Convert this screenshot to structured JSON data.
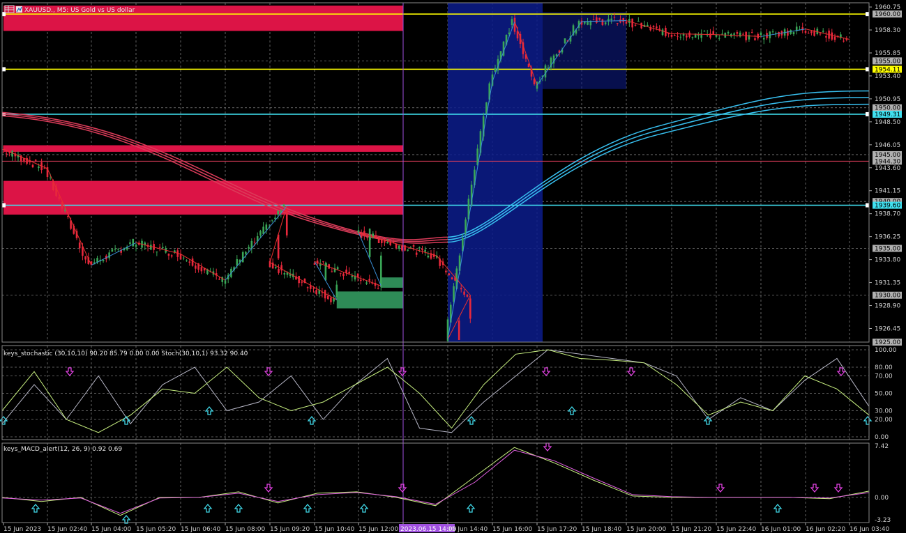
{
  "colors": {
    "background": "#000000",
    "bull_candle": "#3aa757",
    "bear_candle": "#e8283c",
    "session_box": "#0c1c8c",
    "supply_zone": "#dc1446",
    "demand_zone": "#2e8b57",
    "yellow_line": "#ffff00",
    "cyan_line": "#40e0f0",
    "ma_red": "#dc3c5a",
    "ma_blue": "#38c0f0",
    "zigzag_red": "#e83030",
    "zigzag_blue": "#3a8fd8",
    "arrow_down": "#e040e0",
    "arrow_up": "#40d8e8"
  },
  "header": {
    "menu_icon": "chart-window-icon",
    "title": "XAUUSD., M5:  US Gold vs US dollar"
  },
  "main_chart": {
    "price_ticks": [
      "1960.75",
      "1958.30",
      "1955.85",
      "1953.40",
      "1950.95",
      "1948.50",
      "1946.05",
      "1943.60",
      "1941.15",
      "1938.70",
      "1936.25",
      "1933.80",
      "1931.35",
      "1928.90",
      "1926.45"
    ],
    "level_tags": [
      {
        "label": "1960.00",
        "value": 1960.0,
        "bg": "#b0b0b0"
      },
      {
        "label": "1955.00",
        "value": 1955.0,
        "bg": "#b0b0b0"
      },
      {
        "label": "1954.11",
        "value": 1954.11,
        "bg": "#ffff00"
      },
      {
        "label": "1950.00",
        "value": 1950.0,
        "bg": "#b0b0b0"
      },
      {
        "label": "1949.31",
        "value": 1949.31,
        "bg": "#40e0f0"
      },
      {
        "label": "1945.00",
        "value": 1945.0,
        "bg": "#b0b0b0"
      },
      {
        "label": "1944.30",
        "value": 1944.3,
        "bg": "#b0b0b0"
      },
      {
        "label": "1940.00",
        "value": 1940.0,
        "bg": "#b0b0b0"
      },
      {
        "label": "1939.60",
        "value": 1939.6,
        "bg": "#40e0f0"
      },
      {
        "label": "1935.00",
        "value": 1935.0,
        "bg": "#b0b0b0"
      },
      {
        "label": "1930.00",
        "value": 1930.0,
        "bg": "#b0b0b0"
      },
      {
        "label": "1925.00",
        "value": 1925.0,
        "bg": "#b0b0b0"
      }
    ]
  },
  "stoch_panel": {
    "title": "keys_stochastic (30,10,10) 90.20 85.79 0.00 0.00 Stoch(30,10,1) 93.32 90.40",
    "ticks": [
      "100.00",
      "80.00",
      "70.00",
      "50.00",
      "30.00",
      "20.00",
      "0.00"
    ]
  },
  "macd_panel": {
    "title": "keys_MACD_alert(12, 26, 9) 0.92 0.69",
    "ticks": [
      "7.42",
      "0.00",
      "-3.23"
    ]
  },
  "time_axis": {
    "labels": [
      "15 Jun 2023",
      "15 Jun 02:40",
      "15 Jun 04:00",
      "15 Jun 05:20",
      "15 Jun 06:40",
      "15 Jun 08:00",
      "15 Jun 09:20",
      "15 Jun 10:40",
      "15 Jun 12:00",
      "2023.06.15 14:00",
      "15 Jun 14:40",
      "15 Jun 16:00",
      "15 Jun 17:20",
      "15 Jun 18:40",
      "15 Jun 20:00",
      "15 Jun 21:20",
      "15 Jun 22:40",
      "16 Jun 01:00",
      "16 Jun 02:20",
      "16 Jun 03:40"
    ],
    "crosshair_label": "2023.06.15 14:00"
  },
  "chart_data": [
    {
      "type": "candlestick",
      "title": "XAUUSD., M5:  US Gold vs US dollar",
      "symbol": "XAUUSD.",
      "timeframe": "M5",
      "ylim": [
        1925.0,
        1961.2
      ],
      "x_range": [
        "15 Jun 2023",
        "16 Jun 03:40"
      ],
      "close_path": [
        [
          "15 Jun 2023",
          1945.6
        ],
        [
          "15 Jun 02:40",
          1943.5
        ],
        [
          "15 Jun 04:00",
          1933.2
        ],
        [
          "15 Jun 05:20",
          1935.6
        ],
        [
          "15 Jun 06:40",
          1934.4
        ],
        [
          "15 Jun 08:00",
          1931.6
        ],
        [
          "15 Jun 08:30",
          1939.5
        ],
        [
          "15 Jun 09:20",
          1933.5
        ],
        [
          "15 Jun 10:00",
          1929.5
        ],
        [
          "15 Jun 10:40",
          1933.6
        ],
        [
          "15 Jun 11:20",
          1931.0
        ],
        [
          "15 Jun 12:00",
          1936.7
        ],
        [
          "15 Jun 13:00",
          1934.2
        ],
        [
          "15 Jun 14:00",
          1930.0
        ],
        [
          "15 Jun 14:40",
          1925.3
        ],
        [
          "15 Jun 16:00",
          1952.8
        ],
        [
          "15 Jun 16:40",
          1959.2
        ],
        [
          "15 Jun 17:20",
          1952.4
        ],
        [
          "15 Jun 18:00",
          1955.8
        ],
        [
          "15 Jun 18:40",
          1959.2
        ],
        [
          "15 Jun 20:00",
          1959.3
        ],
        [
          "15 Jun 21:20",
          1957.9
        ],
        [
          "15 Jun 22:40",
          1957.8
        ],
        [
          "16 Jun 01:00",
          1957.6
        ],
        [
          "16 Jun 02:20",
          1958.4
        ],
        [
          "16 Jun 03:40",
          1957.3
        ]
      ],
      "zones": [
        {
          "kind": "supply",
          "from": "15 Jun 2023",
          "to": "2023.06.15 14:00",
          "y": [
            1958.2,
            1960.9
          ]
        },
        {
          "kind": "supply",
          "from": "15 Jun 2023",
          "to": "2023.06.15 14:00",
          "y": [
            1945.3,
            1946.0
          ]
        },
        {
          "kind": "supply",
          "from": "15 Jun 2023",
          "to": "2023.06.15 14:00",
          "y": [
            1938.6,
            1942.2
          ]
        },
        {
          "kind": "supply",
          "from": "15 Jun 13:10",
          "to": "2023.06.15 14:00",
          "y": [
            1935.8,
            1937.0
          ]
        },
        {
          "kind": "demand",
          "from": "15 Jun 11:20",
          "to": "2023.06.15 14:00",
          "y": [
            1930.8,
            1931.9
          ]
        },
        {
          "kind": "demand",
          "from": "15 Jun 10:00",
          "to": "2023.06.15 14:00",
          "y": [
            1928.6,
            1930.4
          ]
        },
        {
          "kind": "session",
          "from": "15 Jun 14:40",
          "to": "15 Jun 17:30",
          "y": [
            1925.0,
            1961.2
          ]
        },
        {
          "kind": "session",
          "from": "15 Jun 17:30",
          "to": "15 Jun 20:00",
          "y": [
            1952.0,
            1960.2
          ]
        }
      ],
      "horizontal_lines": [
        {
          "value": 1960.0,
          "color": "yellow"
        },
        {
          "value": 1954.11,
          "color": "yellow"
        },
        {
          "value": 1949.31,
          "color": "cyan"
        },
        {
          "value": 1944.3,
          "color": "red"
        },
        {
          "value": 1939.6,
          "color": "cyan"
        }
      ],
      "moving_averages": {
        "red_group_start": 1949.5,
        "turn": [
          "15 Jun 14:40",
          1936.2
        ],
        "blue_group_end": 1951.8
      }
    },
    {
      "type": "line",
      "title": "keys_stochastic (30,10,10) 90.20 85.79 0.00 0.00 Stoch(30,10,1) 93.32 90.40",
      "ylim": [
        0,
        100
      ],
      "levels": [
        100,
        80,
        70,
        50,
        30,
        20,
        0
      ],
      "series": [
        {
          "name": "Stoch(30,10,1)",
          "values": [
            15,
            60,
            20,
            70,
            15,
            60,
            80,
            30,
            40,
            70,
            20,
            60,
            90,
            10,
            5,
            40,
            70,
            100,
            95,
            90,
            85,
            70,
            20,
            45,
            30,
            65,
            90,
            35
          ]
        },
        {
          "name": "keys_stochastic",
          "values": [
            30,
            75,
            20,
            5,
            25,
            55,
            50,
            80,
            45,
            30,
            40,
            60,
            80,
            50,
            10,
            60,
            95,
            100,
            90,
            88,
            85,
            60,
            25,
            40,
            30,
            70,
            55,
            25
          ]
        }
      ],
      "signals": {
        "up_count": 8,
        "down_count": 6
      }
    },
    {
      "type": "line",
      "title": "keys_MACD_alert(12, 26, 9) 0.92 0.69",
      "ylim": [
        -3.23,
        7.42
      ],
      "series": [
        {
          "name": "MACD",
          "values": [
            0,
            -0.6,
            0,
            -2.6,
            0,
            0,
            0.8,
            -0.8,
            0.6,
            0.8,
            0,
            -1.2,
            3,
            7.2,
            5,
            2.5,
            0.2,
            0,
            0,
            0,
            0,
            -0.2,
            0.9
          ]
        },
        {
          "name": "Signal",
          "values": [
            -0.1,
            -0.4,
            -0.1,
            -2.3,
            -0.1,
            0,
            0.6,
            -0.6,
            0.4,
            0.7,
            0.1,
            -1.0,
            2.2,
            6.8,
            5.3,
            2.8,
            0.4,
            0.1,
            0,
            0,
            0,
            -0.1,
            0.69
          ]
        }
      ],
      "signals": {
        "up_count": 8,
        "down_count": 6
      }
    }
  ]
}
